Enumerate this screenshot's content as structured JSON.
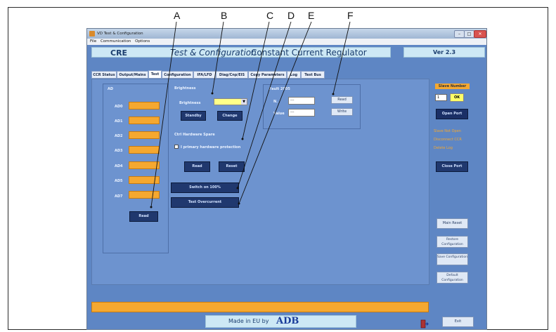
{
  "callouts": [
    "A",
    "B",
    "C",
    "D",
    "E",
    "F"
  ],
  "window": {
    "title": "VD Test & Configuration",
    "controls": {
      "minimize": "–",
      "maximize": "□",
      "close": "✕"
    },
    "menu": [
      "File",
      "Communication",
      "Options"
    ]
  },
  "header": {
    "left": "CRE",
    "title": "Test & Configuration",
    "subtitle": "Constant Current Regulator",
    "version": "Ver 2.3"
  },
  "tabs": [
    "CCR Status",
    "Output/Mains",
    "Test",
    "Configuration",
    "IFA/LFD",
    "Diag/Cnp/EIS",
    "Copy Parameters",
    "Log",
    "Test Bus"
  ],
  "active_tab": "Test",
  "ad_panel": {
    "title": "AD",
    "channels": [
      "AD0",
      "AD1",
      "AD2",
      "AD3",
      "AD4",
      "AD5",
      "AD7"
    ],
    "read_label": "Read"
  },
  "brightness": {
    "title": "Brightness",
    "field_label": "Brightness",
    "dropdown_value": "",
    "standby_label": "Standby",
    "change_label": "Change"
  },
  "fault": {
    "title": "Fault 2005",
    "n_label": "N.",
    "n_value": "---",
    "value_label": "Value",
    "value_value": "---",
    "read_label": "Read",
    "write_label": "Write"
  },
  "ctrl_hw": {
    "title": "Ctrl Hardware Spare",
    "checkbox_label": "I primary hardware protection",
    "read_label": "Read",
    "reset_label": "Reset"
  },
  "switch_label": "Switch on 100%",
  "test_overcurrent_label": "Test Overcurrent",
  "side": {
    "slave_title": "Slave Number",
    "slave_value": "1",
    "ok_label": "OK",
    "open_port_label": "Open Port",
    "status_lines": [
      "Slave Not Open",
      "Disconnect CCR",
      "Delete Log"
    ],
    "close_port_label": "Close Port",
    "main_reset_label": "Main Reset",
    "restore_label": "Restore Configuration",
    "save_label": "Save Configuration",
    "default_label": "Default Configuration",
    "exit_label": "Exit"
  },
  "footer": {
    "made_in": "Made in EU by",
    "brand": "ADB"
  },
  "colors": {
    "window_bg": "#5e86c4",
    "panel_bg": "#6d93cf",
    "orange": "#f5a830",
    "dark_button": "#20386e",
    "header_bg": "#cde8f5"
  }
}
